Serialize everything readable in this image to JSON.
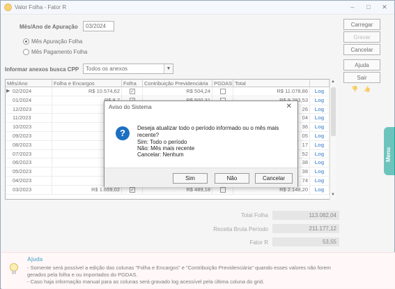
{
  "window": {
    "title": "Valor Folha - Fator R"
  },
  "form": {
    "mes_ano_label": "Mês/Ano de Apuração",
    "mes_ano_value": "03/2024",
    "radio_apuracao": "Mês Apuração Folha",
    "radio_pagamento": "Mês Pagamento Folha",
    "anexos_label": "Informar anexos busca CPP",
    "anexos_value": "Todos os anexos"
  },
  "buttons": {
    "carregar": "Carregar",
    "gravar": "Gravar",
    "cancelar": "Cancelar",
    "ajuda": "Ajuda",
    "sair": "Sair"
  },
  "grid": {
    "headers": [
      "Mês/Ano",
      "Folha e Encargos",
      "Folha",
      "Contribuição Previdenciária",
      "PGDAS",
      "Total",
      ""
    ],
    "rows": [
      {
        "mes": "02/2024",
        "folha_enc": "R$ 10.574,62",
        "folha": "✓",
        "contrib": "R$ 504,24",
        "pgdas": "",
        "total": "R$ 11.078,86",
        "log": "Log"
      },
      {
        "mes": "01/2024",
        "folha_enc": "R$ 8.7",
        "folha": "✓",
        "contrib": "R$ 500,31",
        "pgdas": "",
        "total": "R$ 9.293,53",
        "log": "Log"
      },
      {
        "mes": "12/2023",
        "folha_enc": "R$ 6.",
        "folha": "",
        "contrib": "",
        "pgdas": "",
        "total": "26",
        "log": "Log"
      },
      {
        "mes": "11/2023",
        "folha_enc": "R$ 6.",
        "folha": "",
        "contrib": "",
        "pgdas": "",
        "total": "04",
        "log": "Log"
      },
      {
        "mes": "10/2023",
        "folha_enc": "R$ 6.",
        "folha": "",
        "contrib": "",
        "pgdas": "",
        "total": "36",
        "log": "Log"
      },
      {
        "mes": "09/2023",
        "folha_enc": "R$ 9.",
        "folha": "",
        "contrib": "",
        "pgdas": "",
        "total": "05",
        "log": "Log"
      },
      {
        "mes": "08/2023",
        "folha_enc": "R$ 9.",
        "folha": "",
        "contrib": "",
        "pgdas": "",
        "total": "17",
        "log": "Log"
      },
      {
        "mes": "07/2023",
        "folha_enc": "R$ 9.",
        "folha": "",
        "contrib": "",
        "pgdas": "",
        "total": "52",
        "log": "Log"
      },
      {
        "mes": "06/2023",
        "folha_enc": "R$ 6.",
        "folha": "",
        "contrib": "",
        "pgdas": "",
        "total": "38",
        "log": "Log"
      },
      {
        "mes": "05/2023",
        "folha_enc": "R$ 6.",
        "folha": "",
        "contrib": "",
        "pgdas": "",
        "total": "38",
        "log": "Log"
      },
      {
        "mes": "04/2023",
        "folha_enc": "R$ 6.",
        "folha": "",
        "contrib": "",
        "pgdas": "",
        "total": "74",
        "log": "Log"
      },
      {
        "mes": "03/2023",
        "folha_enc": "R$ 1.659,02",
        "folha": "✓",
        "contrib": "R$ 489,18",
        "pgdas": "",
        "total": "R$ 2.148,20",
        "log": "Log"
      }
    ]
  },
  "totals": {
    "total_folha_label": "Total Folha",
    "total_folha_value": "113.082,04",
    "receita_label": "Receita Bruta Período",
    "receita_value": "211.177,12",
    "fator_label": "Fator R",
    "fator_value": "53,55"
  },
  "help": {
    "title": "Ajuda",
    "line1": "- Somente será possível a edição das colunas \"Folha e Encargos\" e \"Contribuição Previdenciária\" quando esses valores não forem",
    "line2": "gerados pela folha e ou importados do PGDAS.",
    "line3": "- Caso haja informação manual para as colunas será gravado log acessível pela última coluna do grid."
  },
  "menu_tab": "Menu",
  "dialog": {
    "title": "Aviso do Sistema",
    "line1": "Deseja atualizar todo o período informado ou o mês mais",
    "line2": "recente?",
    "line3": "Sim: Todo o período",
    "line4": "Não: Mês mais recente",
    "line5": "Cancelar: Nenhum",
    "sim": "Sim",
    "nao": "Não",
    "cancelar": "Cancelar"
  },
  "colors": {
    "accent": "#1fa59a",
    "link": "#1a6bc2",
    "dialog_icon": "#1d6fc1"
  }
}
